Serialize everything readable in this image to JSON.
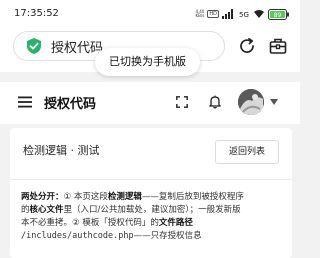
{
  "status_bar": {
    "time": "17:35:52",
    "net_speed_value": "4.40",
    "net_speed_unit": "KB/s",
    "hd_label": "HD",
    "network_label": "5G",
    "battery_level": "89"
  },
  "address_bar": {
    "url_text": "授权代码"
  },
  "toast": {
    "message": "已切换为手机版"
  },
  "app_bar": {
    "title": "授权代码"
  },
  "card": {
    "title": "检测逻辑 · 测试",
    "back_button": "返回列表",
    "description": {
      "lead": "两处分开：",
      "l1_a": "① 本页这段",
      "l1_bold": "检测逻辑",
      "l1_b": "——复制后放到被授权程序",
      "l2_a": "的",
      "l2_bold": "核心文件",
      "l2_b": "里（入口/公共加载处，建议加密）；一般发新版",
      "l3": "本不必重拷。② 模板「授权代码」的",
      "l3_bold": "文件路径",
      "l4_code": "/includes/authcode.php",
      "l4_b": "——只存授权信息"
    }
  },
  "colors": {
    "accent_green": "#26b36b",
    "text_primary": "#111111",
    "page_background": "#f2f2f2"
  },
  "icons": {
    "address_left": "shield-check-icon",
    "reload": "reload-icon",
    "toolbox": "toolbox-icon",
    "menu": "hamburger-menu-icon",
    "fullscreen": "fullscreen-icon",
    "notifications": "bell-icon",
    "avatar_dropdown": "caret-down-icon"
  }
}
